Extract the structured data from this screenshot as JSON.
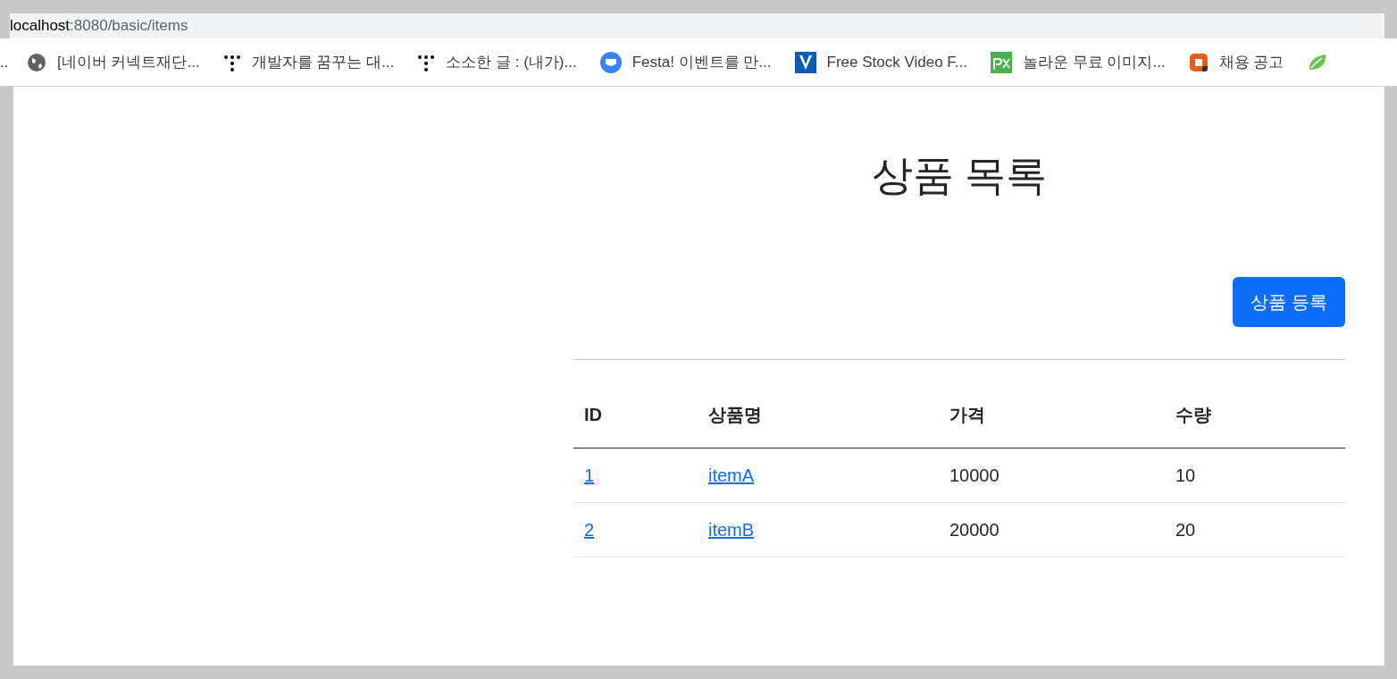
{
  "address_bar": {
    "host": "localhost",
    "path": ":8080/basic/items"
  },
  "bookmarks_overflow": "..",
  "bookmarks": [
    {
      "kind": "globe",
      "label": "[네이버 커넥트재단..."
    },
    {
      "kind": "dots",
      "label": "개발자를 꿈꾸는 대..."
    },
    {
      "kind": "dots",
      "label": "소소한 글 : (내가)..."
    },
    {
      "kind": "chat",
      "label": "Festa! 이벤트를 만..."
    },
    {
      "kind": "v",
      "label": "Free Stock Video F..."
    },
    {
      "kind": "px",
      "label": "놀라운 무료 이미지..."
    },
    {
      "kind": "square",
      "label": "채용 공고"
    },
    {
      "kind": "leaf"
    }
  ],
  "page": {
    "title": "상품 목록",
    "add_button": "상품 등록",
    "table": {
      "columns": [
        "ID",
        "상품명",
        "가격",
        "수량"
      ],
      "rows": [
        {
          "id": "1",
          "name": "itemA",
          "price": "10000",
          "quantity": "10"
        },
        {
          "id": "2",
          "name": "itemB",
          "price": "20000",
          "quantity": "20"
        }
      ]
    }
  }
}
